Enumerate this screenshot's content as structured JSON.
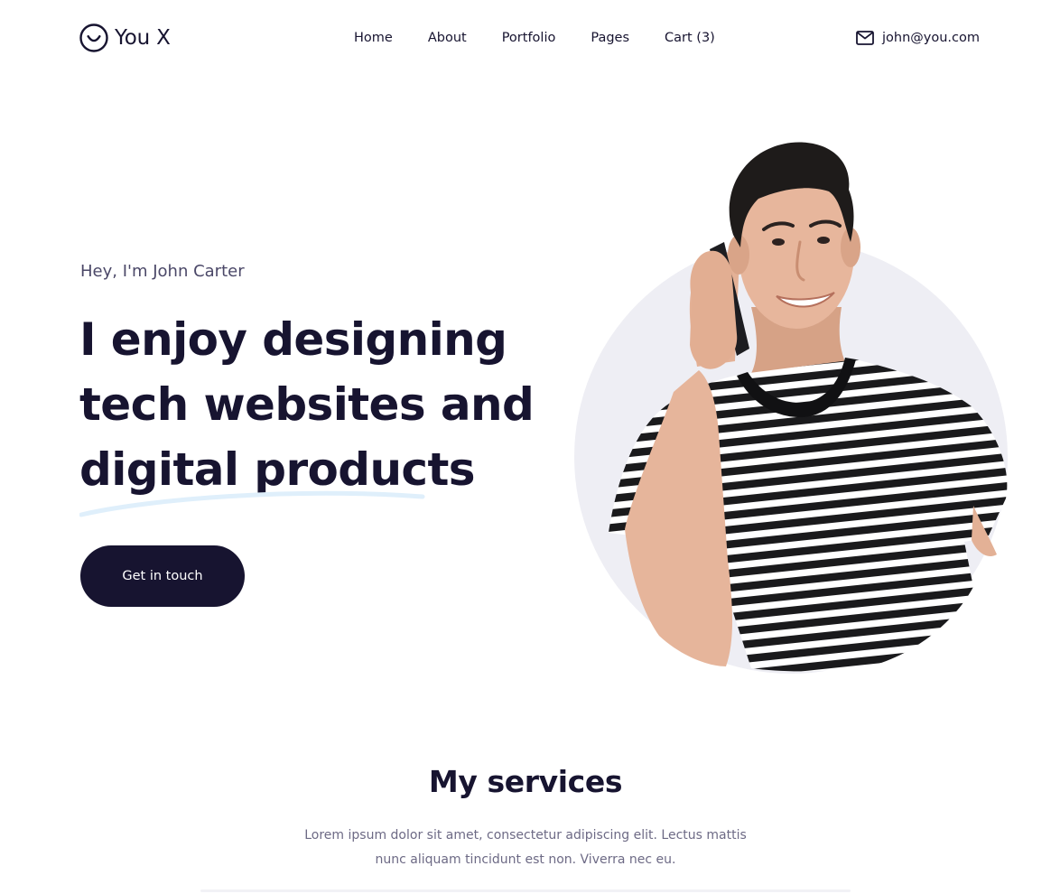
{
  "brand": {
    "name": "You X",
    "icon": "smile-circle-icon"
  },
  "nav": {
    "items": [
      {
        "label": "Home"
      },
      {
        "label": "About"
      },
      {
        "label": "Portfolio"
      },
      {
        "label": "Pages"
      },
      {
        "label": "Cart (3)"
      }
    ]
  },
  "contact": {
    "icon": "mail-icon",
    "email": "john@you.com"
  },
  "hero": {
    "eyebrow": "Hey, I'm John Carter",
    "title_lines": [
      "I enjoy designing",
      "tech websites and",
      "digital products"
    ],
    "cta_label": "Get in touch",
    "portrait_subject": "man in striped t-shirt talking on phone"
  },
  "services": {
    "title": "My services",
    "description": "Lorem ipsum dolor sit amet, consectetur adipiscing elit. Lectus mattis nunc aliquam tincidunt est non. Viverra nec eu."
  },
  "colors": {
    "primary": "#171430",
    "muted_text": "#6d6a85",
    "portrait_circle": "#eeeef4",
    "underline_accent": "#dfeffb"
  }
}
